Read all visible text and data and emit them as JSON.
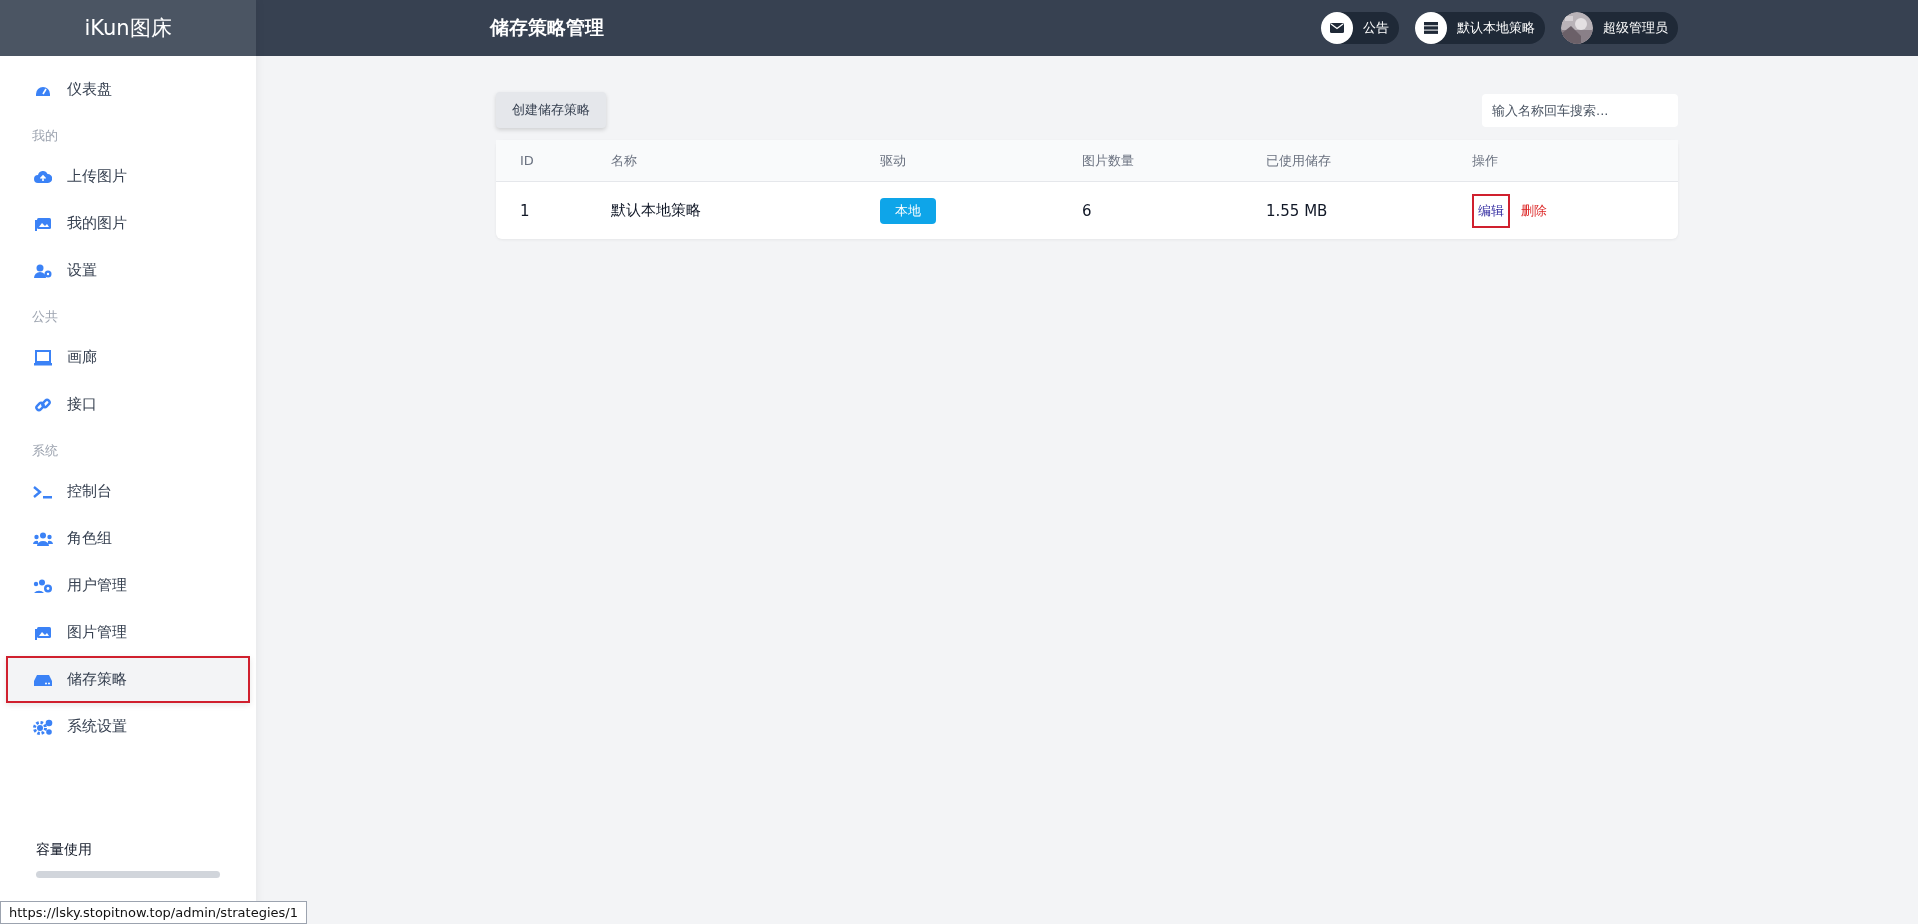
{
  "sidebar": {
    "brand": "iKun图床",
    "items": [
      {
        "kind": "link",
        "label": "仪表盘",
        "selected": false,
        "highlighted": false
      },
      {
        "kind": "heading",
        "label": "我的"
      },
      {
        "kind": "link",
        "label": "上传图片",
        "selected": false,
        "highlighted": false
      },
      {
        "kind": "link",
        "label": "我的图片",
        "selected": false,
        "highlighted": false
      },
      {
        "kind": "link",
        "label": "设置",
        "selected": false,
        "highlighted": false
      },
      {
        "kind": "heading",
        "label": "公共"
      },
      {
        "kind": "link",
        "label": "画廊",
        "selected": false,
        "highlighted": false
      },
      {
        "kind": "link",
        "label": "接口",
        "selected": false,
        "highlighted": false
      },
      {
        "kind": "heading",
        "label": "系统"
      },
      {
        "kind": "link",
        "label": "控制台",
        "selected": false,
        "highlighted": false
      },
      {
        "kind": "link",
        "label": "角色组",
        "selected": false,
        "highlighted": false
      },
      {
        "kind": "link",
        "label": "用户管理",
        "selected": false,
        "highlighted": false
      },
      {
        "kind": "link",
        "label": "图片管理",
        "selected": false,
        "highlighted": false
      },
      {
        "kind": "link",
        "label": "储存策略",
        "selected": true,
        "highlighted": true
      },
      {
        "kind": "link",
        "label": "系统设置",
        "selected": false,
        "highlighted": false
      }
    ],
    "capacity": {
      "label": "容量使用",
      "level": 0
    }
  },
  "header": {
    "title": "储存策略管理",
    "actions": [
      {
        "kind": "notice",
        "label": "公告"
      },
      {
        "kind": "strategy",
        "label": "默认本地策略"
      },
      {
        "kind": "user",
        "label": "超级管理员"
      }
    ]
  },
  "toolbar": {
    "create_button": "创建储存策略",
    "search": {
      "placeholder": "输入名称回车搜索..."
    }
  },
  "table": {
    "columns": [
      "ID",
      "名称",
      "驱动",
      "图片数量",
      "已使用储存",
      "操作"
    ],
    "rows": [
      {
        "id": "1",
        "name": "默认本地策略",
        "driver": "本地",
        "count": "6",
        "used": "1.55 MB",
        "actions": [
          {
            "kind": "edit",
            "label": "编辑",
            "highlighted": true
          },
          {
            "kind": "delete",
            "label": "删除",
            "highlighted": false
          }
        ]
      }
    ]
  },
  "status_url": "https://lsky.stopitnow.top/admin/strategies/1"
}
